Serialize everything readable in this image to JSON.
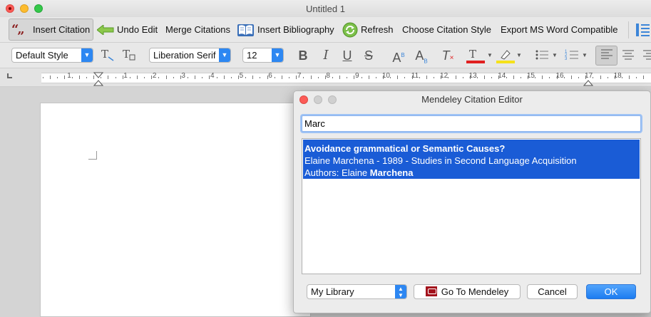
{
  "window": {
    "title": "Untitled 1"
  },
  "mendeley_toolbar": {
    "insert_citation": "Insert Citation",
    "undo_edit": "Undo Edit",
    "merge_citations": "Merge Citations",
    "insert_bibliography": "Insert Bibliography",
    "refresh": "Refresh",
    "choose_citation_style": "Choose Citation Style",
    "export_ms_word": "Export MS Word Compatible"
  },
  "format_toolbar": {
    "paragraph_style": "Default Style",
    "font_name": "Liberation Serif",
    "font_size": "12",
    "font_color": "#e02020",
    "highlight_color": "#f5e11b"
  },
  "ruler": {
    "numbers": [
      "1",
      "1",
      "2",
      "3",
      "4",
      "5",
      "6",
      "7",
      "8",
      "9",
      "10",
      "11",
      "12",
      "13",
      "14",
      "15",
      "16",
      "17",
      "18"
    ]
  },
  "dialog": {
    "title": "Mendeley Citation Editor",
    "search_value": "Marc",
    "result": {
      "title": "Avoidance grammatical or Semantic Causes?",
      "line2": "Elaine Marchena - 1989 - Studies in Second Language Acquisition",
      "authors_prefix": "Authors: Elaine ",
      "authors_highlight": "Marchena"
    },
    "library_select": "My Library",
    "go_to_mendeley": "Go To Mendeley",
    "cancel": "Cancel",
    "ok": "OK"
  }
}
